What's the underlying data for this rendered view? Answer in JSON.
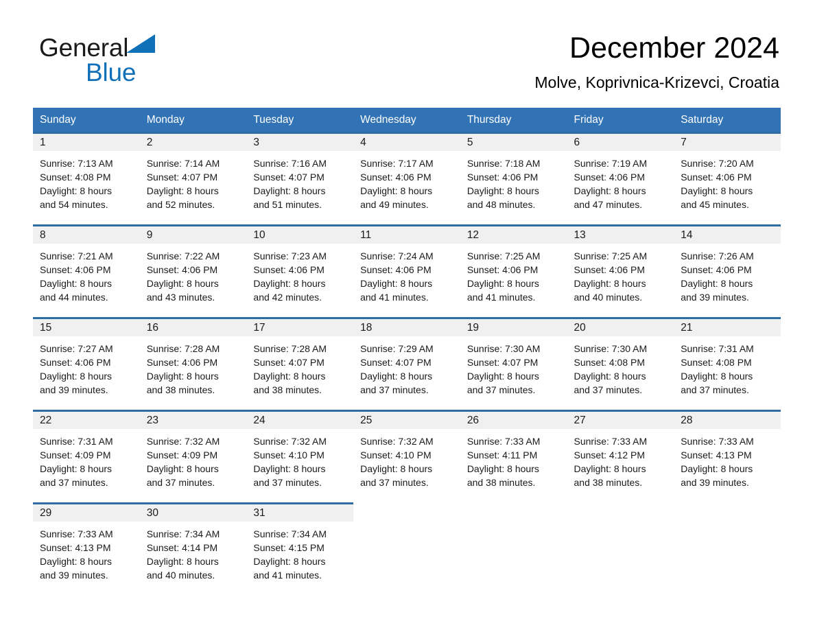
{
  "brand": {
    "name_part1": "General",
    "name_part2": "Blue",
    "triangle_icon": "brand-triangle-icon",
    "colors": {
      "blue": "#1070b8",
      "black": "#1a1a1a"
    }
  },
  "header": {
    "title": "December 2024",
    "subtitle": "Molve, Koprivnica-Krizevci, Croatia"
  },
  "theme": {
    "header_blue": "#3273b5",
    "row_border_blue": "#2e6da4",
    "daynum_band": "#f0f0f0"
  },
  "calendar": {
    "weekday_headers": [
      "Sunday",
      "Monday",
      "Tuesday",
      "Wednesday",
      "Thursday",
      "Friday",
      "Saturday"
    ],
    "weeks": [
      [
        {
          "day": "1",
          "sunrise": "Sunrise: 7:13 AM",
          "sunset": "Sunset: 4:08 PM",
          "daylight1": "Daylight: 8 hours",
          "daylight2": "and 54 minutes."
        },
        {
          "day": "2",
          "sunrise": "Sunrise: 7:14 AM",
          "sunset": "Sunset: 4:07 PM",
          "daylight1": "Daylight: 8 hours",
          "daylight2": "and 52 minutes."
        },
        {
          "day": "3",
          "sunrise": "Sunrise: 7:16 AM",
          "sunset": "Sunset: 4:07 PM",
          "daylight1": "Daylight: 8 hours",
          "daylight2": "and 51 minutes."
        },
        {
          "day": "4",
          "sunrise": "Sunrise: 7:17 AM",
          "sunset": "Sunset: 4:06 PM",
          "daylight1": "Daylight: 8 hours",
          "daylight2": "and 49 minutes."
        },
        {
          "day": "5",
          "sunrise": "Sunrise: 7:18 AM",
          "sunset": "Sunset: 4:06 PM",
          "daylight1": "Daylight: 8 hours",
          "daylight2": "and 48 minutes."
        },
        {
          "day": "6",
          "sunrise": "Sunrise: 7:19 AM",
          "sunset": "Sunset: 4:06 PM",
          "daylight1": "Daylight: 8 hours",
          "daylight2": "and 47 minutes."
        },
        {
          "day": "7",
          "sunrise": "Sunrise: 7:20 AM",
          "sunset": "Sunset: 4:06 PM",
          "daylight1": "Daylight: 8 hours",
          "daylight2": "and 45 minutes."
        }
      ],
      [
        {
          "day": "8",
          "sunrise": "Sunrise: 7:21 AM",
          "sunset": "Sunset: 4:06 PM",
          "daylight1": "Daylight: 8 hours",
          "daylight2": "and 44 minutes."
        },
        {
          "day": "9",
          "sunrise": "Sunrise: 7:22 AM",
          "sunset": "Sunset: 4:06 PM",
          "daylight1": "Daylight: 8 hours",
          "daylight2": "and 43 minutes."
        },
        {
          "day": "10",
          "sunrise": "Sunrise: 7:23 AM",
          "sunset": "Sunset: 4:06 PM",
          "daylight1": "Daylight: 8 hours",
          "daylight2": "and 42 minutes."
        },
        {
          "day": "11",
          "sunrise": "Sunrise: 7:24 AM",
          "sunset": "Sunset: 4:06 PM",
          "daylight1": "Daylight: 8 hours",
          "daylight2": "and 41 minutes."
        },
        {
          "day": "12",
          "sunrise": "Sunrise: 7:25 AM",
          "sunset": "Sunset: 4:06 PM",
          "daylight1": "Daylight: 8 hours",
          "daylight2": "and 41 minutes."
        },
        {
          "day": "13",
          "sunrise": "Sunrise: 7:25 AM",
          "sunset": "Sunset: 4:06 PM",
          "daylight1": "Daylight: 8 hours",
          "daylight2": "and 40 minutes."
        },
        {
          "day": "14",
          "sunrise": "Sunrise: 7:26 AM",
          "sunset": "Sunset: 4:06 PM",
          "daylight1": "Daylight: 8 hours",
          "daylight2": "and 39 minutes."
        }
      ],
      [
        {
          "day": "15",
          "sunrise": "Sunrise: 7:27 AM",
          "sunset": "Sunset: 4:06 PM",
          "daylight1": "Daylight: 8 hours",
          "daylight2": "and 39 minutes."
        },
        {
          "day": "16",
          "sunrise": "Sunrise: 7:28 AM",
          "sunset": "Sunset: 4:06 PM",
          "daylight1": "Daylight: 8 hours",
          "daylight2": "and 38 minutes."
        },
        {
          "day": "17",
          "sunrise": "Sunrise: 7:28 AM",
          "sunset": "Sunset: 4:07 PM",
          "daylight1": "Daylight: 8 hours",
          "daylight2": "and 38 minutes."
        },
        {
          "day": "18",
          "sunrise": "Sunrise: 7:29 AM",
          "sunset": "Sunset: 4:07 PM",
          "daylight1": "Daylight: 8 hours",
          "daylight2": "and 37 minutes."
        },
        {
          "day": "19",
          "sunrise": "Sunrise: 7:30 AM",
          "sunset": "Sunset: 4:07 PM",
          "daylight1": "Daylight: 8 hours",
          "daylight2": "and 37 minutes."
        },
        {
          "day": "20",
          "sunrise": "Sunrise: 7:30 AM",
          "sunset": "Sunset: 4:08 PM",
          "daylight1": "Daylight: 8 hours",
          "daylight2": "and 37 minutes."
        },
        {
          "day": "21",
          "sunrise": "Sunrise: 7:31 AM",
          "sunset": "Sunset: 4:08 PM",
          "daylight1": "Daylight: 8 hours",
          "daylight2": "and 37 minutes."
        }
      ],
      [
        {
          "day": "22",
          "sunrise": "Sunrise: 7:31 AM",
          "sunset": "Sunset: 4:09 PM",
          "daylight1": "Daylight: 8 hours",
          "daylight2": "and 37 minutes."
        },
        {
          "day": "23",
          "sunrise": "Sunrise: 7:32 AM",
          "sunset": "Sunset: 4:09 PM",
          "daylight1": "Daylight: 8 hours",
          "daylight2": "and 37 minutes."
        },
        {
          "day": "24",
          "sunrise": "Sunrise: 7:32 AM",
          "sunset": "Sunset: 4:10 PM",
          "daylight1": "Daylight: 8 hours",
          "daylight2": "and 37 minutes."
        },
        {
          "day": "25",
          "sunrise": "Sunrise: 7:32 AM",
          "sunset": "Sunset: 4:10 PM",
          "daylight1": "Daylight: 8 hours",
          "daylight2": "and 37 minutes."
        },
        {
          "day": "26",
          "sunrise": "Sunrise: 7:33 AM",
          "sunset": "Sunset: 4:11 PM",
          "daylight1": "Daylight: 8 hours",
          "daylight2": "and 38 minutes."
        },
        {
          "day": "27",
          "sunrise": "Sunrise: 7:33 AM",
          "sunset": "Sunset: 4:12 PM",
          "daylight1": "Daylight: 8 hours",
          "daylight2": "and 38 minutes."
        },
        {
          "day": "28",
          "sunrise": "Sunrise: 7:33 AM",
          "sunset": "Sunset: 4:13 PM",
          "daylight1": "Daylight: 8 hours",
          "daylight2": "and 39 minutes."
        }
      ],
      [
        {
          "day": "29",
          "sunrise": "Sunrise: 7:33 AM",
          "sunset": "Sunset: 4:13 PM",
          "daylight1": "Daylight: 8 hours",
          "daylight2": "and 39 minutes."
        },
        {
          "day": "30",
          "sunrise": "Sunrise: 7:34 AM",
          "sunset": "Sunset: 4:14 PM",
          "daylight1": "Daylight: 8 hours",
          "daylight2": "and 40 minutes."
        },
        {
          "day": "31",
          "sunrise": "Sunrise: 7:34 AM",
          "sunset": "Sunset: 4:15 PM",
          "daylight1": "Daylight: 8 hours",
          "daylight2": "and 41 minutes."
        },
        {
          "day": "",
          "sunrise": "",
          "sunset": "",
          "daylight1": "",
          "daylight2": ""
        },
        {
          "day": "",
          "sunrise": "",
          "sunset": "",
          "daylight1": "",
          "daylight2": ""
        },
        {
          "day": "",
          "sunrise": "",
          "sunset": "",
          "daylight1": "",
          "daylight2": ""
        },
        {
          "day": "",
          "sunrise": "",
          "sunset": "",
          "daylight1": "",
          "daylight2": ""
        }
      ]
    ]
  }
}
